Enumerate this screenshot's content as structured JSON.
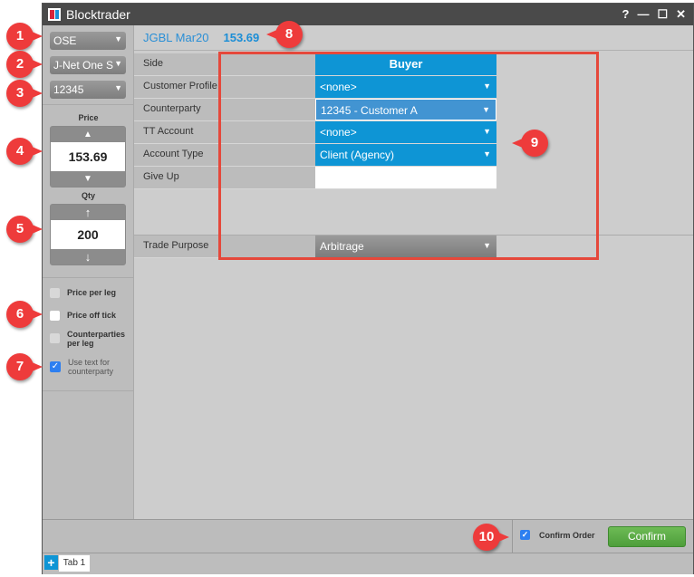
{
  "window": {
    "title": "Blocktrader",
    "controls": [
      "?",
      "—",
      "☐",
      "✕"
    ]
  },
  "left": {
    "exchange": "OSE",
    "gateway": "J-Net One S",
    "account": "12345",
    "price_label": "Price",
    "price": "153.69",
    "qty_label": "Qty",
    "qty": "200",
    "checkboxes": [
      {
        "label": "Price per leg",
        "checked": false
      },
      {
        "label": "Price off tick",
        "checked": false
      },
      {
        "label": "Counterparties per leg",
        "checked": false
      },
      {
        "label": "Use text for counterparty",
        "checked": true
      }
    ]
  },
  "header": {
    "instrument": "JGBL Mar20",
    "price": "153.69"
  },
  "form": {
    "rows": [
      {
        "label": "Side",
        "value": "Buyer"
      },
      {
        "label": "Customer Profile",
        "value": "<none>"
      },
      {
        "label": "Counterparty",
        "value": "12345 - Customer A"
      },
      {
        "label": "TT Account",
        "value": "<none>"
      },
      {
        "label": "Account Type",
        "value": "Client (Agency)"
      },
      {
        "label": "Give Up",
        "value": ""
      }
    ],
    "trade_purpose": {
      "label": "Trade Purpose",
      "value": "Arbitrage"
    }
  },
  "footer": {
    "confirm_order_label": "Confirm Order",
    "confirm_order_checked": true,
    "confirm_button": "Confirm"
  },
  "tabs": [
    {
      "label": "Tab 1"
    }
  ],
  "callouts": [
    "1",
    "2",
    "3",
    "4",
    "5",
    "6",
    "7",
    "8",
    "9",
    "10"
  ],
  "colors": {
    "accent": "#0e95d5",
    "confirm": "#5aae43",
    "callout": "#ee3b3b"
  }
}
